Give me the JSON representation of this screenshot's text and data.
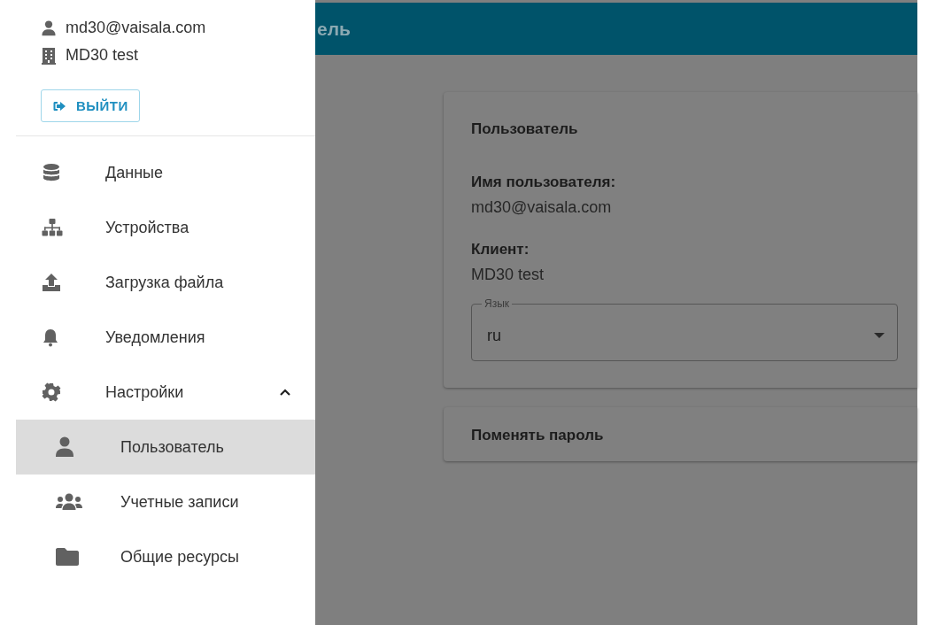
{
  "account": {
    "email": "md30@vaisala.com",
    "client": "MD30 test"
  },
  "logout_button": {
    "label": "ВЫЙТИ"
  },
  "nav": [
    {
      "label": "Данные",
      "selected": false
    },
    {
      "label": "Устройства",
      "selected": false
    },
    {
      "label": "Загрузка файла",
      "selected": false
    },
    {
      "label": "Уведомления",
      "selected": false
    },
    {
      "label": "Настройки",
      "selected": false,
      "expanded": true,
      "children": [
        {
          "label": "Пользователь",
          "selected": true
        },
        {
          "label": "Учетные записи",
          "selected": false
        },
        {
          "label": "Общие ресурсы",
          "selected": false
        }
      ]
    }
  ],
  "header": {
    "title": "ель"
  },
  "user_card": {
    "title": "Пользователь",
    "fields": [
      {
        "label": "Имя пользователя:",
        "value": "md30@vaisala.com"
      },
      {
        "label": "Клиент:",
        "value": "MD30 test"
      }
    ],
    "language": {
      "label": "Язык",
      "value": "ru"
    }
  },
  "password_panel": {
    "title": "Поменять пароль"
  }
}
